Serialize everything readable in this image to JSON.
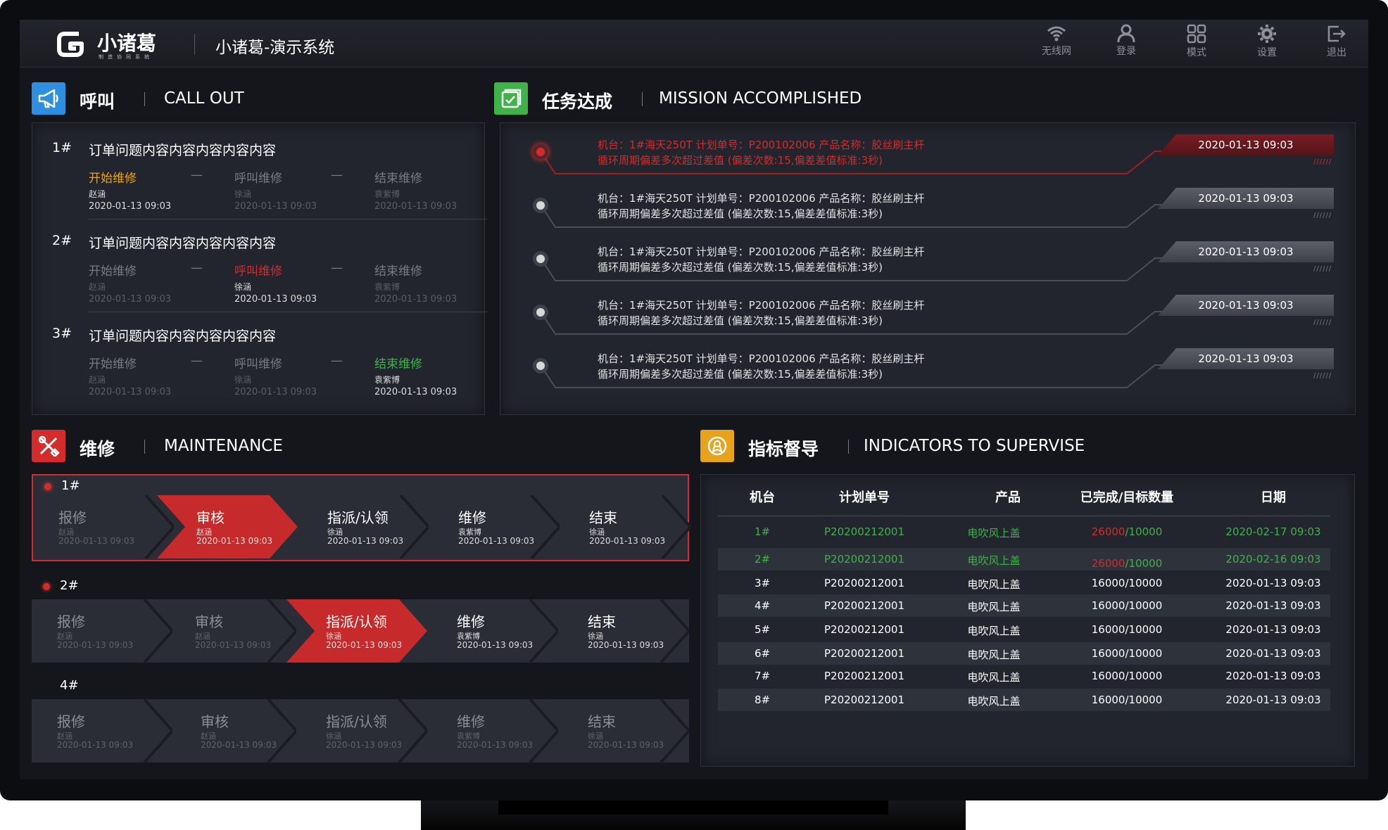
{
  "header": {
    "logo_text": "小诸葛",
    "logo_sub": "制造协同系统",
    "system_title": "小诸葛-演示系统",
    "icons": [
      {
        "label": "无线网",
        "icon": "wifi-icon"
      },
      {
        "label": "登录",
        "icon": "user-icon"
      },
      {
        "label": "模式",
        "icon": "grid-icon"
      },
      {
        "label": "设置",
        "icon": "gear-icon"
      },
      {
        "label": "退出",
        "icon": "logout-icon"
      }
    ]
  },
  "call_out": {
    "title_cn": "呼叫",
    "title_en": "CALL OUT",
    "items": [
      {
        "index": "1#",
        "title": "订单问题内容内容内容内容内容",
        "steps": [
          {
            "name": "开始维修",
            "person": "赵涵",
            "time": "2020-01-13 09:03",
            "state": "active-yellow"
          },
          {
            "name": "呼叫维修",
            "person": "徐涵",
            "time": "2020-01-13 09:03",
            "state": "pending"
          },
          {
            "name": "结束维修",
            "person": "袁紫博",
            "time": "2020-01-13 09:03",
            "state": "pending"
          }
        ]
      },
      {
        "index": "2#",
        "title": "订单问题内容内容内容内容内容",
        "steps": [
          {
            "name": "开始维修",
            "person": "赵涵",
            "time": "2020-01-13 09:03",
            "state": "pending"
          },
          {
            "name": "呼叫维修",
            "person": "徐涵",
            "time": "2020-01-13 09:03",
            "state": "active-red"
          },
          {
            "name": "结束维修",
            "person": "袁紫博",
            "time": "2020-01-13 09:03",
            "state": "pending"
          }
        ]
      },
      {
        "index": "3#",
        "title": "订单问题内容内容内容内容内容",
        "steps": [
          {
            "name": "开始维修",
            "person": "赵涵",
            "time": "2020-01-13 09:03",
            "state": "pending"
          },
          {
            "name": "呼叫维修",
            "person": "徐涵",
            "time": "2020-01-13 09:03",
            "state": "pending"
          },
          {
            "name": "结束维修",
            "person": "袁紫博",
            "time": "2020-01-13 09:03",
            "state": "active-green"
          }
        ]
      }
    ],
    "dash": "—"
  },
  "mission": {
    "title_cn": "任务达成",
    "title_en": "MISSION ACCOMPLISHED",
    "items": [
      {
        "line1": "机台：1#海天250T   计划单号：P200102006   产品名称：胶丝刷主杆",
        "line2": "循环周期偏差多次超过差值 (偏差次数:15,偏差差值标准:3秒)",
        "time": "2020-01-13 09:03",
        "alert": true
      },
      {
        "line1": "机台：1#海天250T   计划单号：P200102006   产品名称：胶丝刷主杆",
        "line2": "循环周期偏差多次超过差值 (偏差次数:15,偏差差值标准:3秒)",
        "time": "2020-01-13 09:03",
        "alert": false
      },
      {
        "line1": "机台：1#海天250T   计划单号：P200102006   产品名称：胶丝刷主杆",
        "line2": "循环周期偏差多次超过差值 (偏差次数:15,偏差差值标准:3秒)",
        "time": "2020-01-13 09:03",
        "alert": false
      },
      {
        "line1": "机台：1#海天250T   计划单号：P200102006   产品名称：胶丝刷主杆",
        "line2": "循环周期偏差多次超过差值 (偏差次数:15,偏差差值标准:3秒)",
        "time": "2020-01-13 09:03",
        "alert": false
      },
      {
        "line1": "机台：1#海天250T   计划单号：P200102006   产品名称：胶丝刷主杆",
        "line2": "循环周期偏差多次超过差值 (偏差次数:15,偏差差值标准:3秒)",
        "time": "2020-01-13 09:03",
        "alert": false
      }
    ]
  },
  "maintenance": {
    "title_cn": "维修",
    "title_en": "MAINTENANCE",
    "rows": [
      {
        "label": "1#",
        "has_dot": true,
        "selected": true,
        "steps": [
          {
            "name": "报修",
            "person": "赵涵",
            "time": "2020-01-13 09:03",
            "state": "done"
          },
          {
            "name": "审核",
            "person": "赵涵",
            "time": "2020-01-13 09:03",
            "state": "active"
          },
          {
            "name": "指派/认领",
            "person": "徐涵",
            "time": "2020-01-13 09:03",
            "state": "todo"
          },
          {
            "name": "维修",
            "person": "袁紫博",
            "time": "2020-01-13 09:03",
            "state": "todo"
          },
          {
            "name": "结束",
            "person": "徐涵",
            "time": "2020-01-13 09:03",
            "state": "todo"
          }
        ]
      },
      {
        "label": "2#",
        "has_dot": true,
        "selected": false,
        "steps": [
          {
            "name": "报修",
            "person": "赵涵",
            "time": "2020-01-13 09:03",
            "state": "done"
          },
          {
            "name": "审核",
            "person": "赵涵",
            "time": "2020-01-13 09:03",
            "state": "done"
          },
          {
            "name": "指派/认领",
            "person": "徐涵",
            "time": "2020-01-13 09:03",
            "state": "active"
          },
          {
            "name": "维修",
            "person": "袁紫博",
            "time": "2020-01-13 09:03",
            "state": "todo"
          },
          {
            "name": "结束",
            "person": "徐涵",
            "time": "2020-01-13 09:03",
            "state": "todo"
          }
        ]
      },
      {
        "label": "4#",
        "has_dot": false,
        "selected": false,
        "steps": [
          {
            "name": "报修",
            "person": "赵涵",
            "time": "2020-01-13 09:03",
            "state": "done"
          },
          {
            "name": "审核",
            "person": "赵涵",
            "time": "2020-01-13 09:03",
            "state": "done"
          },
          {
            "name": "指派/认领",
            "person": "徐涵",
            "time": "2020-01-13 09:03",
            "state": "done"
          },
          {
            "name": "维修",
            "person": "袁紫博",
            "time": "2020-01-13 09:03",
            "state": "done"
          },
          {
            "name": "结束",
            "person": "徐涵",
            "time": "2020-01-13 09:03",
            "state": "done"
          }
        ]
      }
    ]
  },
  "indicators": {
    "title_cn": "指标督导",
    "title_en": "INDICATORS TO SUPERVISE",
    "columns": [
      "机台",
      "计划单号",
      "产品",
      "已完成/目标数量",
      "日期"
    ],
    "rows": [
      {
        "machine": "1#",
        "plan": "P20200212001",
        "product": "电吹风上盖",
        "done": "26000",
        "target": "/10000",
        "date": "2020-02-17 09:03",
        "style": "green"
      },
      {
        "machine": "2#",
        "plan": "P20200212001",
        "product": "电吹风上盖",
        "done": "26000",
        "target": "/10000",
        "date": "2020-02-16 09:03",
        "style": "green"
      },
      {
        "machine": "3#",
        "plan": "P20200212001",
        "product": "电吹风上盖",
        "done": "16000",
        "target": "/10000",
        "date": "2020-01-13 09:03",
        "style": "normal"
      },
      {
        "machine": "4#",
        "plan": "P20200212001",
        "product": "电吹风上盖",
        "done": "16000",
        "target": "/10000",
        "date": "2020-01-13 09:03",
        "style": "normal"
      },
      {
        "machine": "5#",
        "plan": "P20200212001",
        "product": "电吹风上盖",
        "done": "16000",
        "target": "/10000",
        "date": "2020-01-13 09:03",
        "style": "normal"
      },
      {
        "machine": "6#",
        "plan": "P20200212001",
        "product": "电吹风上盖",
        "done": "16000",
        "target": "/10000",
        "date": "2020-01-13 09:03",
        "style": "normal"
      },
      {
        "machine": "7#",
        "plan": "P20200212001",
        "product": "电吹风上盖",
        "done": "16000",
        "target": "/10000",
        "date": "2020-01-13 09:03",
        "style": "normal"
      },
      {
        "machine": "8#",
        "plan": "P20200212001",
        "product": "电吹风上盖",
        "done": "16000",
        "target": "/10000",
        "date": "2020-01-13 09:03",
        "style": "normal"
      }
    ]
  },
  "colors": {
    "red": "#d42b2b",
    "green": "#3fb24a",
    "yellow": "#e8a31c",
    "blue": "#2e8fe0",
    "bg": "#14161b"
  }
}
